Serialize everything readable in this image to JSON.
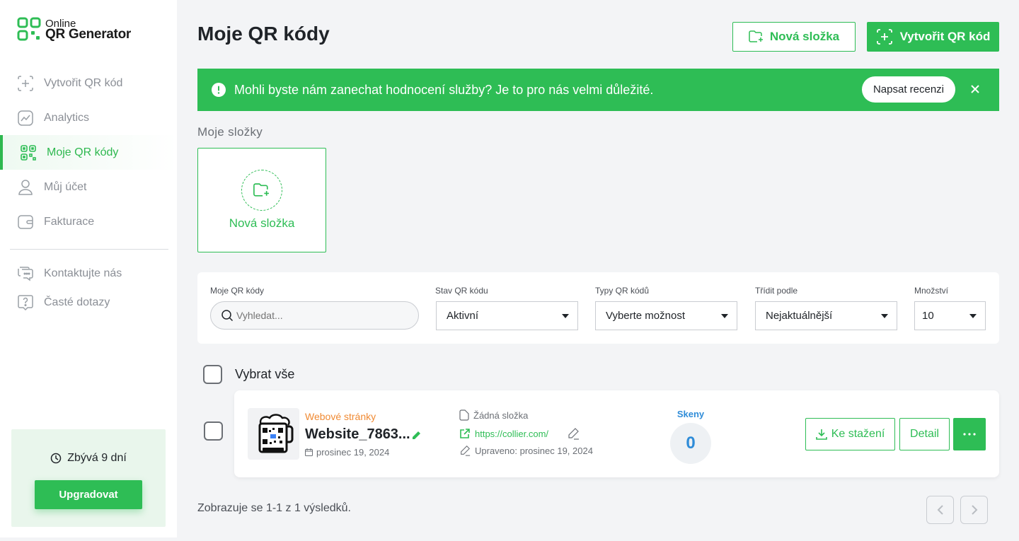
{
  "logo": {
    "line1": "Online",
    "line2": "QR Generator"
  },
  "sidebar": {
    "items": [
      {
        "label": "Vytvořit QR kód",
        "icon": "plus-square-icon"
      },
      {
        "label": "Analytics",
        "icon": "chart-icon"
      },
      {
        "label": "Moje QR kódy",
        "icon": "qr-grid-icon",
        "active": true
      },
      {
        "label": "Můj účet",
        "icon": "user-icon"
      },
      {
        "label": "Fakturace",
        "icon": "wallet-icon"
      }
    ],
    "secondary": [
      {
        "label": "Kontaktujte nás",
        "icon": "chat-icon"
      },
      {
        "label": "Časté dotazy",
        "icon": "help-icon"
      }
    ],
    "trial": {
      "text": "Zbývá 9 dní",
      "button": "Upgradovat"
    }
  },
  "header": {
    "title": "Moje QR kódy",
    "new_folder": "Nová složka",
    "create": "Vytvořit QR kód"
  },
  "banner": {
    "message": "Mohli byste nám zanechat hodnocení služby? Je to pro nás velmi důležité.",
    "review_button": "Napsat recenzi"
  },
  "folders": {
    "heading": "Moje složky",
    "new_folder_card": "Nová složka"
  },
  "filters": {
    "search": {
      "label": "Moje QR kódy",
      "placeholder": "Vyhledat..."
    },
    "status": {
      "label": "Stav QR kódu",
      "value": "Aktivní"
    },
    "types": {
      "label": "Typy QR kódů",
      "value": "Vyberte možnost"
    },
    "sort": {
      "label": "Třídit podle",
      "value": "Nejaktuálnější"
    },
    "quantity": {
      "label": "Množství",
      "value": "10"
    }
  },
  "list": {
    "select_all": "Vybrat vše",
    "items": [
      {
        "type": "Webové stránky",
        "name": "Website_7863...",
        "date": "prosinec 19, 2024",
        "folder": "Žádná složka",
        "url": "https://collier.com/",
        "edited": "Upraveno: prosinec 19, 2024",
        "scans_label": "Skeny",
        "scans": "0",
        "download": "Ke stažení",
        "detail": "Detail"
      }
    ]
  },
  "pagination": {
    "summary": "Zobrazuje se 1-1 z 1 výsledků."
  },
  "colors": {
    "accent": "#2ebd55",
    "type_label": "#f08a33",
    "scans": "#2f8cd8"
  }
}
